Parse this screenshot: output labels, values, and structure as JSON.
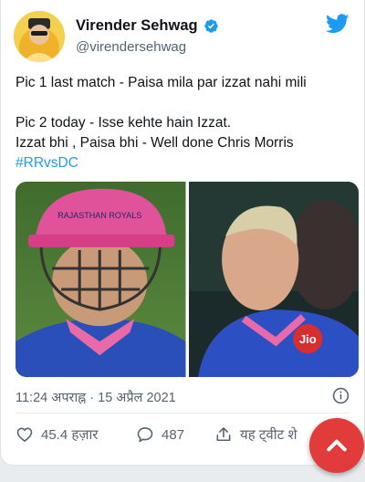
{
  "user": {
    "name": "Virender Sehwag",
    "handle": "@virendersehwag",
    "verified": true
  },
  "tweet": {
    "lines": [
      "Pic 1 last match - Paisa mila par izzat nahi mili",
      "Pic 2 today - Isse kehte hain Izzat.",
      "Izzat bhi , Paisa bhi - Well done Chris Morris"
    ],
    "hashtag": "#RRvsDC"
  },
  "media": {
    "pic1_caption": "RAJASTHAN ROYALS",
    "pic2_caption": "Jio"
  },
  "timestamp": "11:24 अपराह्न · 15 अप्रैल 2021",
  "actions": {
    "likes": "45.4 हज़ार",
    "comments": "487",
    "share_label": "यह ट्वीट शे"
  },
  "colors": {
    "accent": "#1d9bf0",
    "fab": "#e23b3b",
    "muted": "#536471"
  }
}
